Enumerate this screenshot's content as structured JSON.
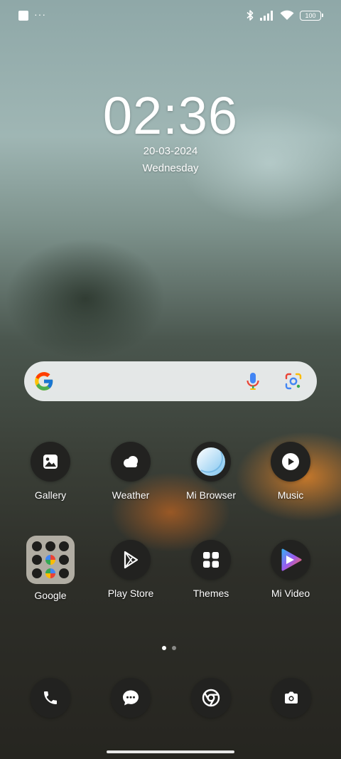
{
  "status_bar": {
    "battery": "100",
    "icons": [
      "notification-square-icon",
      "more-dots-icon",
      "bluetooth-icon",
      "signal-icon",
      "wifi-icon",
      "battery-icon"
    ]
  },
  "clock": {
    "time": "02:36",
    "date": "20-03-2024",
    "weekday": "Wednesday"
  },
  "search": {
    "icons": [
      "google-g-icon",
      "microphone-icon",
      "google-lens-icon"
    ]
  },
  "apps": [
    {
      "label": "Gallery",
      "icon": "gallery-icon"
    },
    {
      "label": "Weather",
      "icon": "weather-cloud-icon"
    },
    {
      "label": "Mi Browser",
      "icon": "browser-icon"
    },
    {
      "label": "Music",
      "icon": "music-play-icon"
    },
    {
      "label": "Google",
      "icon": "folder-icon"
    },
    {
      "label": "Play Store",
      "icon": "play-store-icon"
    },
    {
      "label": "Themes",
      "icon": "themes-grid-icon"
    },
    {
      "label": "Mi Video",
      "icon": "mi-video-icon"
    }
  ],
  "pages": {
    "count": 2,
    "active": 1
  },
  "dock": [
    "phone-icon",
    "messages-icon",
    "chrome-icon",
    "camera-icon"
  ],
  "colors": {
    "icon_bg": "#222220",
    "search_bg": "#f0f3f3",
    "accent_orange": "#f58c28"
  }
}
